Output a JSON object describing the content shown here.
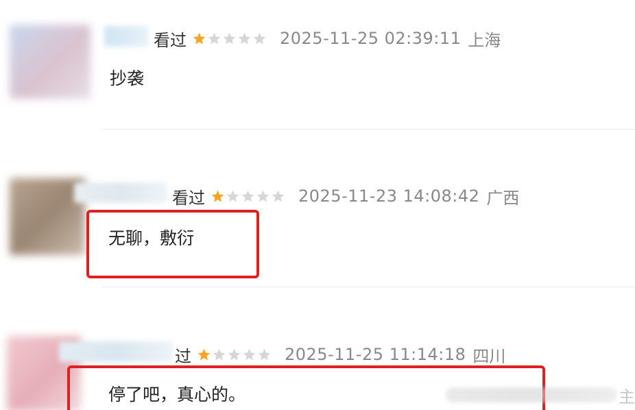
{
  "reviews": [
    {
      "status": "看过",
      "rating": 1,
      "max_rating": 5,
      "timestamp": "2025-11-25 02:39:11",
      "location": "上海",
      "comment": "抄袭",
      "highlighted": false
    },
    {
      "status": "看过",
      "rating": 1,
      "max_rating": 5,
      "timestamp": "2025-11-23 14:08:42",
      "location": "广西",
      "comment": "无聊，敷衍",
      "highlighted": true
    },
    {
      "status": "过",
      "rating": 1,
      "max_rating": 5,
      "timestamp": "2025-11-25 11:14:18",
      "location": "四川",
      "comment": "停了吧，真心的。",
      "highlighted": true
    }
  ],
  "watermark": {
    "text": "主"
  },
  "colors": {
    "star_filled": "#f5a623",
    "star_empty": "#d6d6d6",
    "highlight_border": "#e02020",
    "meta_text": "#888888"
  },
  "icons": {
    "star": "star-icon",
    "avatar": "blurred-avatar"
  }
}
